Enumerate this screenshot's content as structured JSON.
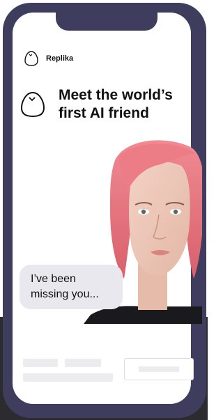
{
  "app": {
    "brand_name": "Replika",
    "logo_icon": "egg-logo-icon"
  },
  "hero": {
    "title_line1": "Meet the world’s",
    "title_line2": "first AI friend"
  },
  "chat": {
    "bubble_line1": "I’ve been",
    "bubble_line2": "missing you..."
  },
  "colors": {
    "phone_frame": "#3e3d5e",
    "bubble_bg": "#e8e8ee",
    "page_bottom": "#2b2b30",
    "hair": "#e4747d"
  }
}
